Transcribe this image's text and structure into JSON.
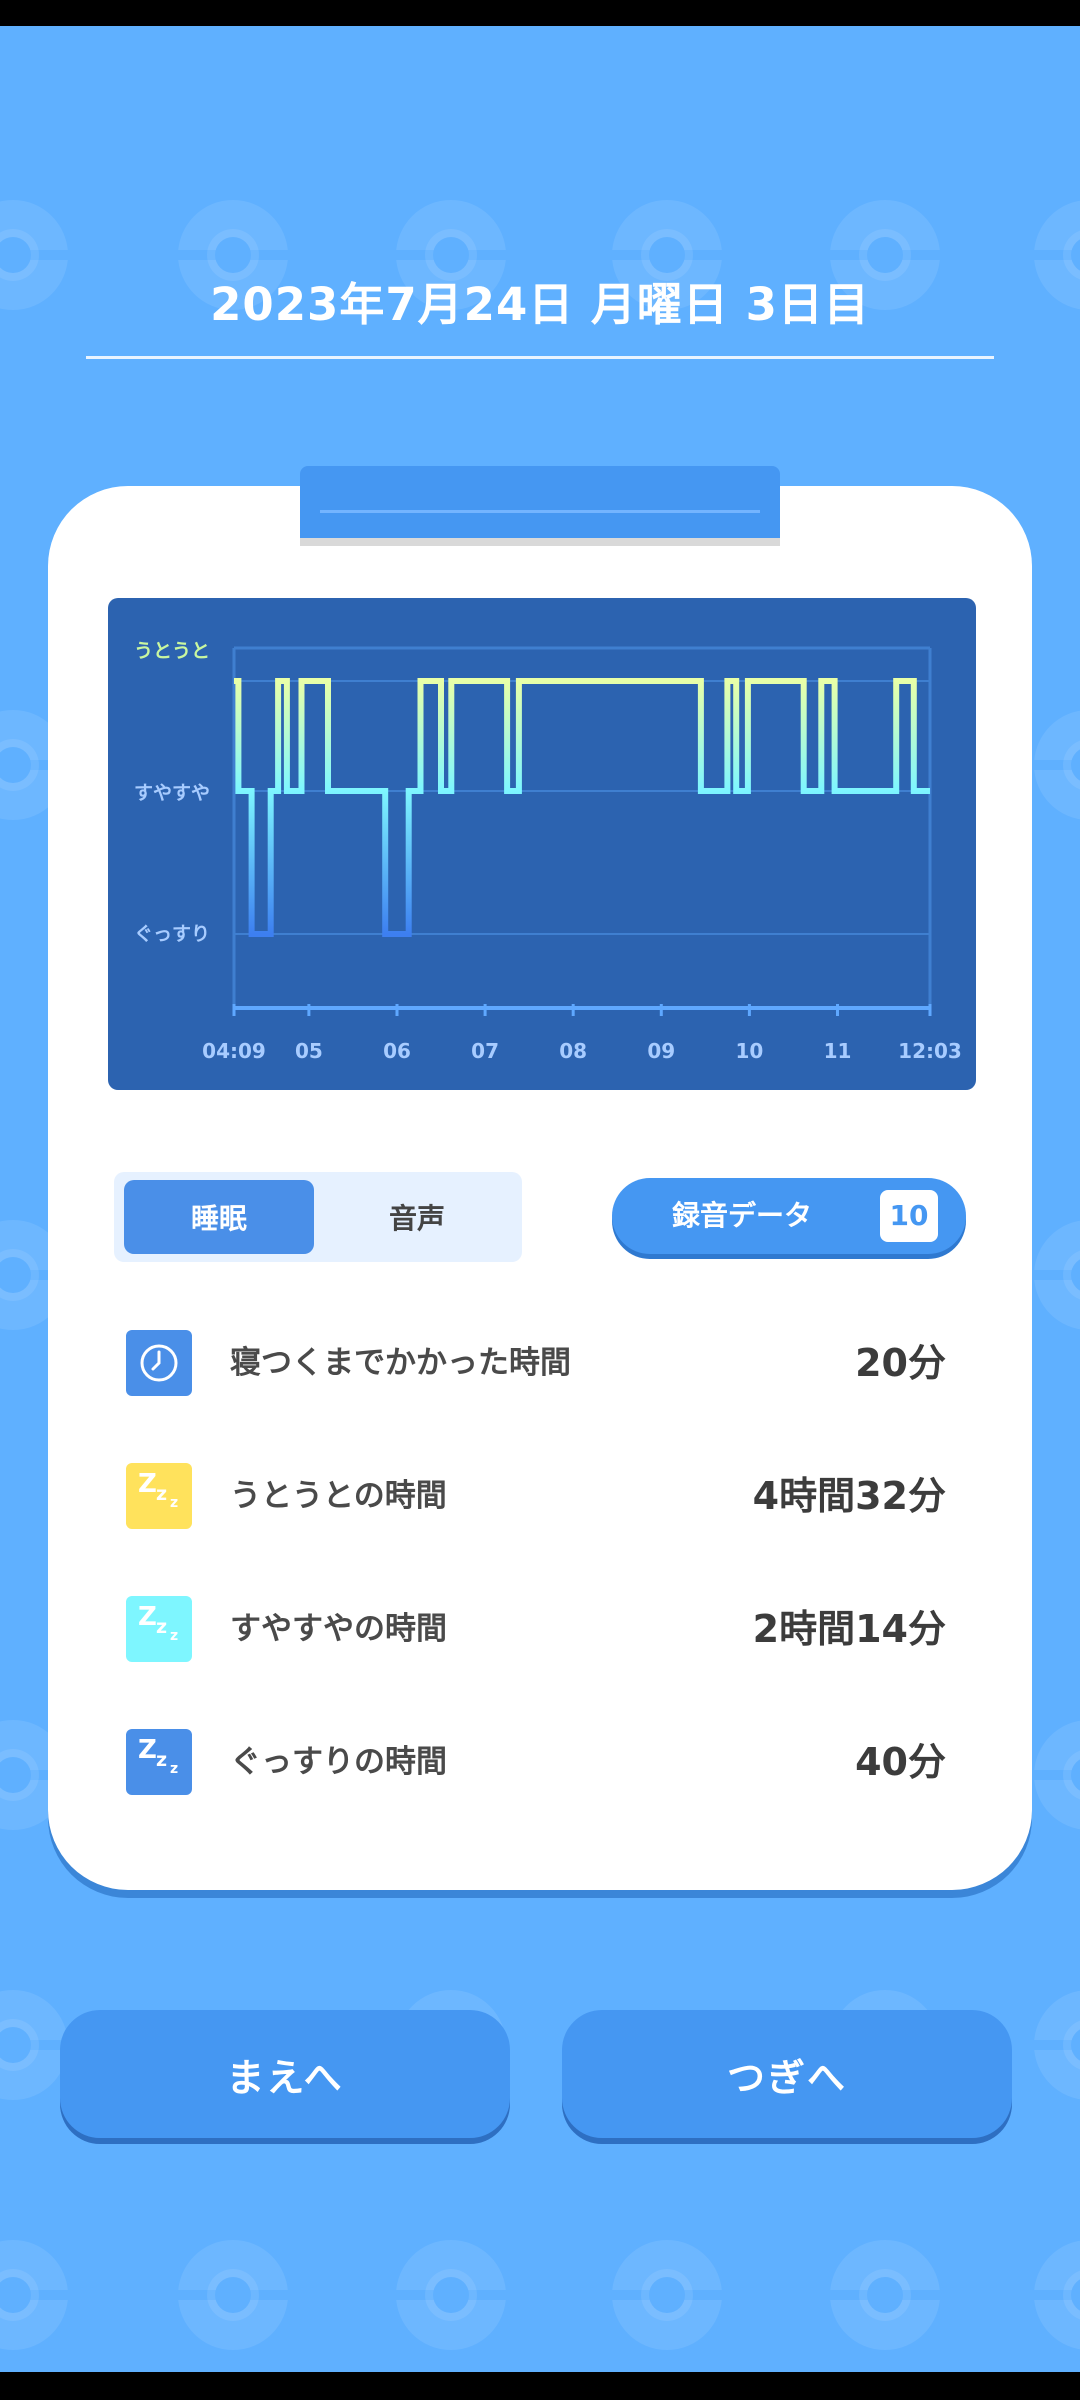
{
  "header": {
    "date_title": "2023年7月24日 月曜日 3日目"
  },
  "chart_data": {
    "type": "line",
    "title": "",
    "y_levels": [
      "うとうと",
      "すやすや",
      "ぐっすり"
    ],
    "x_tick_labels": [
      "04:09",
      "05",
      "06",
      "07",
      "08",
      "09",
      "10",
      "11",
      "12:03"
    ],
    "x_range": [
      "04:09",
      "12:03"
    ],
    "series": [
      {
        "segments": [
          {
            "start": "04:09",
            "end": "04:12",
            "level": "うとうと"
          },
          {
            "start": "04:12",
            "end": "04:21",
            "level": "すやすや"
          },
          {
            "start": "04:21",
            "end": "04:34",
            "level": "ぐっすり"
          },
          {
            "start": "04:34",
            "end": "04:39",
            "level": "すやすや"
          },
          {
            "start": "04:39",
            "end": "04:45",
            "level": "うとうと"
          },
          {
            "start": "04:45",
            "end": "04:55",
            "level": "すやすや"
          },
          {
            "start": "04:55",
            "end": "05:13",
            "level": "うとうと"
          },
          {
            "start": "05:13",
            "end": "05:52",
            "level": "すやすや"
          },
          {
            "start": "05:52",
            "end": "06:08",
            "level": "ぐっすり"
          },
          {
            "start": "06:08",
            "end": "06:16",
            "level": "すやすや"
          },
          {
            "start": "06:16",
            "end": "06:30",
            "level": "うとうと"
          },
          {
            "start": "06:30",
            "end": "06:37",
            "level": "すやすや"
          },
          {
            "start": "06:37",
            "end": "07:15",
            "level": "うとうと"
          },
          {
            "start": "07:15",
            "end": "07:23",
            "level": "すやすや"
          },
          {
            "start": "07:23",
            "end": "09:27",
            "level": "うとうと"
          },
          {
            "start": "09:27",
            "end": "09:45",
            "level": "すやすや"
          },
          {
            "start": "09:45",
            "end": "09:51",
            "level": "うとうと"
          },
          {
            "start": "09:51",
            "end": "09:59",
            "level": "すやすや"
          },
          {
            "start": "09:59",
            "end": "10:37",
            "level": "うとうと"
          },
          {
            "start": "10:37",
            "end": "10:49",
            "level": "すやすや"
          },
          {
            "start": "10:49",
            "end": "10:58",
            "level": "うとうと"
          },
          {
            "start": "10:58",
            "end": "11:40",
            "level": "すやすや"
          },
          {
            "start": "11:40",
            "end": "11:52",
            "level": "うとうと"
          },
          {
            "start": "11:52",
            "end": "12:03",
            "level": "すやすや"
          }
        ]
      }
    ],
    "colors": {
      "うとうと": "#e8ffa8",
      "すやすや": "#7ef6ff",
      "ぐっすり": "#3d7ff0"
    },
    "grid": true
  },
  "tabs": {
    "sleep": "睡眠",
    "audio": "音声"
  },
  "recording": {
    "label": "録音データ",
    "count": "10"
  },
  "stats": [
    {
      "label": "寝つくまでかかった時間",
      "value": "20分",
      "icon": "clock-icon",
      "color": "#4a8fe8"
    },
    {
      "label": "うとうとの時間",
      "value": "4時間32分",
      "icon": "zzz-icon",
      "color": "#ffe25c"
    },
    {
      "label": "すやすやの時間",
      "value": "2時間14分",
      "icon": "zzz-icon",
      "color": "#7ef6ff"
    },
    {
      "label": "ぐっすりの時間",
      "value": "40分",
      "icon": "zzz-icon",
      "color": "#4a8fe8"
    }
  ],
  "nav": {
    "prev": "まえへ",
    "next": "つぎへ"
  }
}
